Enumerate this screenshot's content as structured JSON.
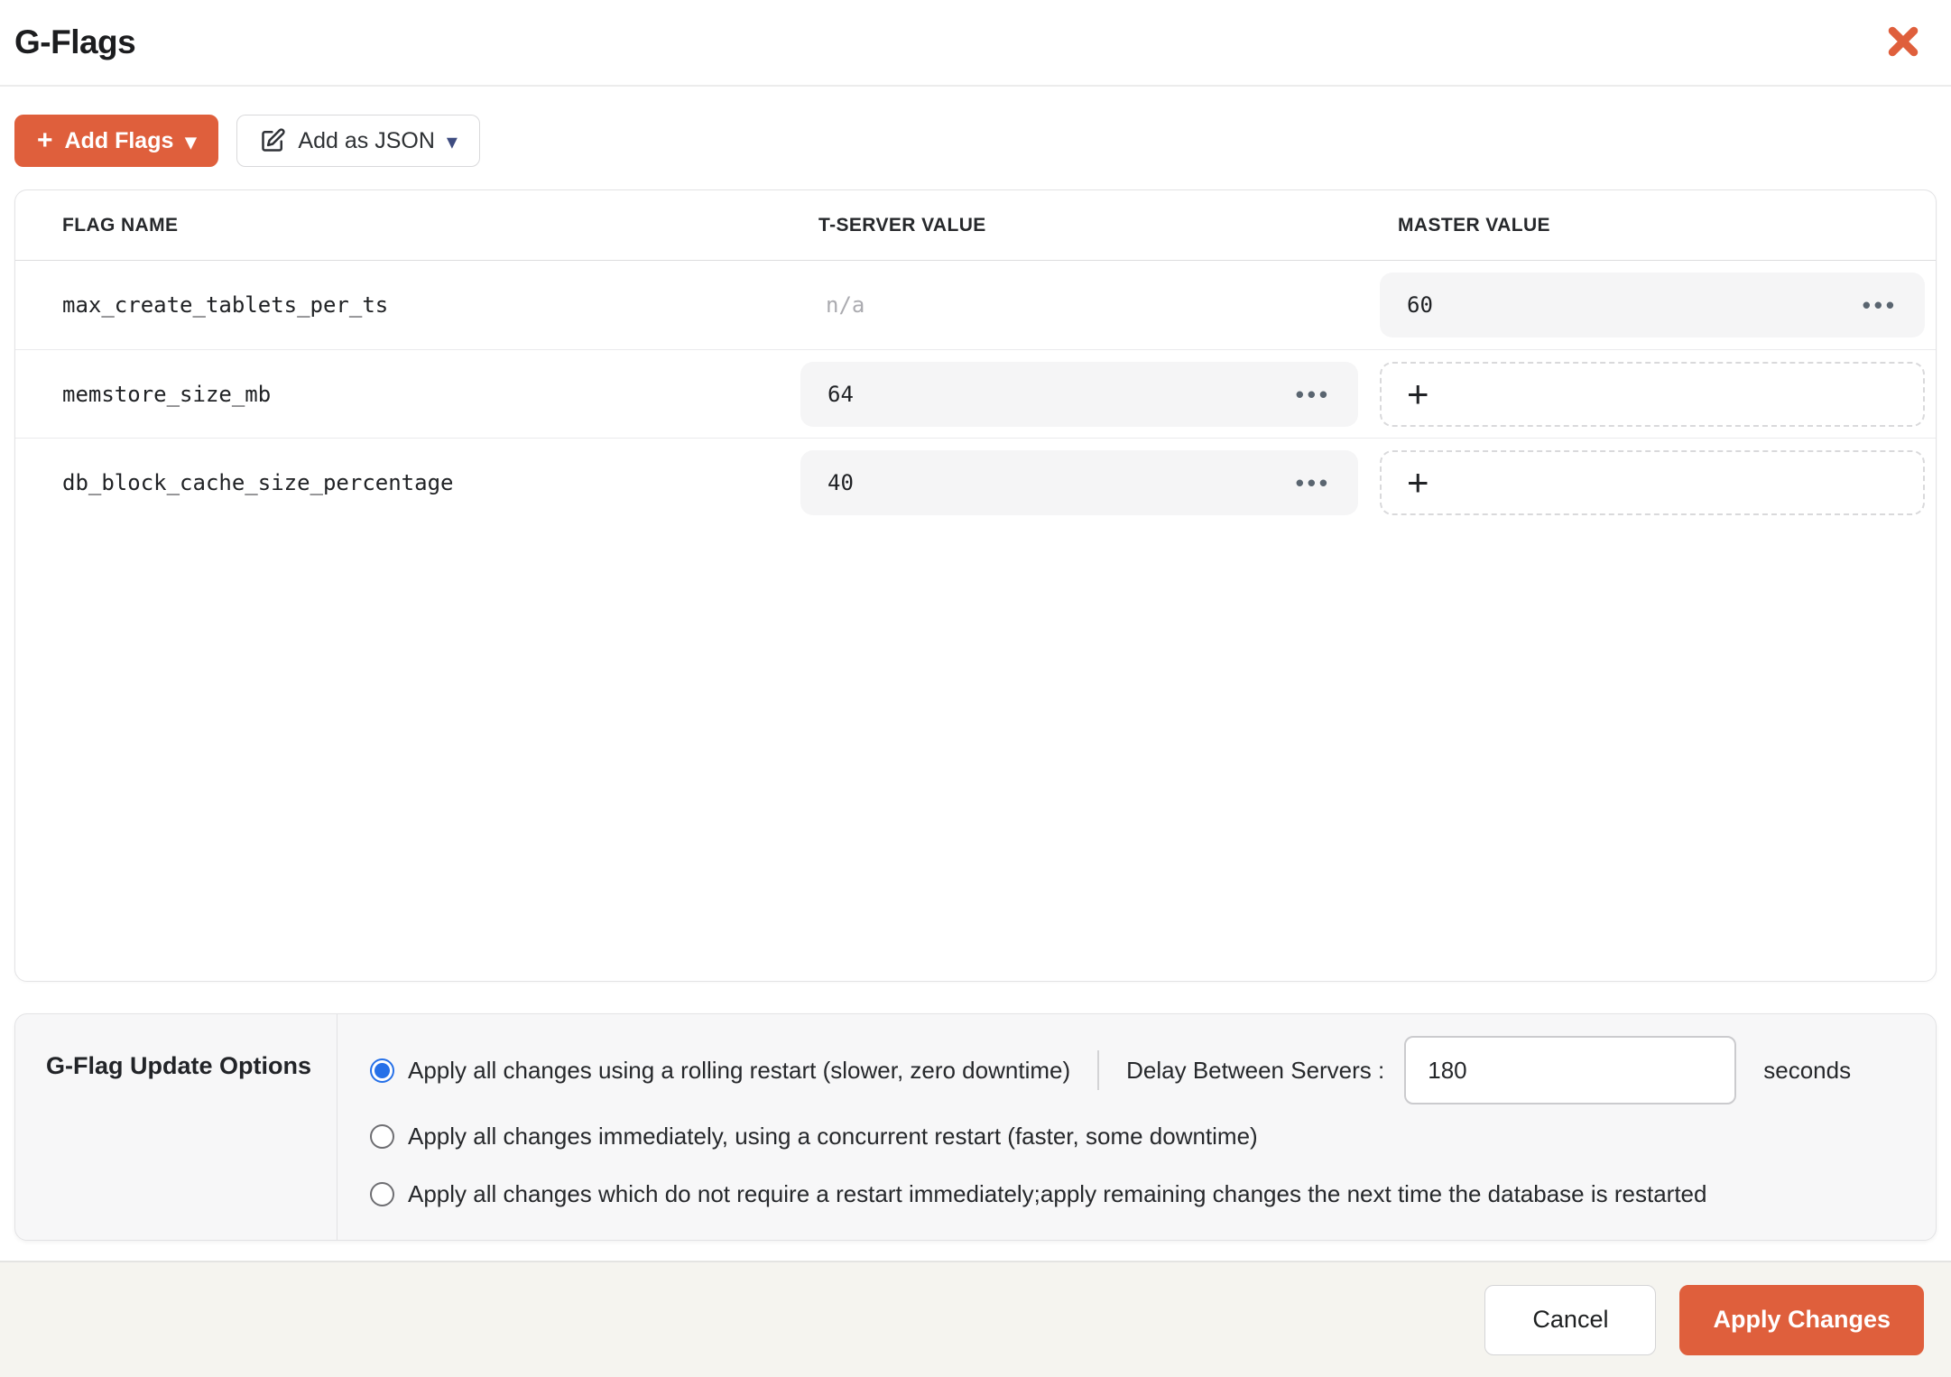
{
  "modal": {
    "title": "G-Flags"
  },
  "toolbar": {
    "add_flags_label": "Add Flags",
    "add_as_json_label": "Add as JSON"
  },
  "icons": {
    "plus_icon": "+",
    "caret_down_icon": "▾",
    "more_icon": "•••",
    "add_value_icon": "+",
    "close_icon": "✕",
    "edit_icon": "✎"
  },
  "table": {
    "columns": [
      "FLAG NAME",
      "T-SERVER VALUE",
      "MASTER VALUE"
    ],
    "rows": [
      {
        "flag_name": "max_create_tablets_per_ts",
        "tserver_value": "n/a",
        "master_value": "60"
      },
      {
        "flag_name": "memstore_size_mb",
        "tserver_value": "64",
        "master_value": ""
      },
      {
        "flag_name": "db_block_cache_size_percentage",
        "tserver_value": "40",
        "master_value": ""
      }
    ]
  },
  "options": {
    "title": "G-Flag Update Options",
    "radios": [
      {
        "label": "Apply all changes using a rolling restart (slower, zero downtime)",
        "selected": true
      },
      {
        "label": "Apply all changes immediately, using a concurrent restart (faster, some downtime)",
        "selected": false
      },
      {
        "label": "Apply all changes which do not require a restart immediately;apply remaining changes the next time the database is restarted",
        "selected": false
      }
    ],
    "delay": {
      "label": "Delay Between Servers :",
      "value": "180",
      "unit": "seconds"
    }
  },
  "footer": {
    "cancel_label": "Cancel",
    "apply_label": "Apply Changes"
  },
  "colors": {
    "accent_orange": "#DF5F3C",
    "radio_blue": "#2670E8",
    "caret_navy": "#3E4C80",
    "footer_bg": "#F5F4EF",
    "pill_bg": "#F5F5F6"
  }
}
